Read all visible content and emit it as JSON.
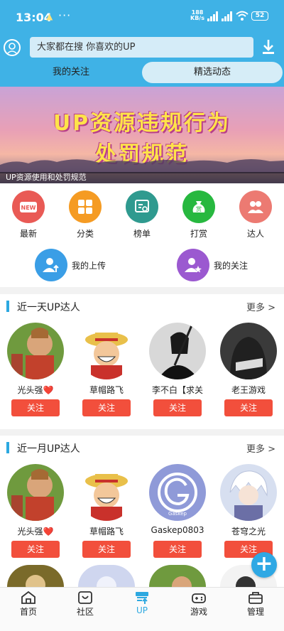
{
  "status_bar": {
    "time": "13:04",
    "dots": "···",
    "net_speed_top": "188",
    "net_speed_bottom": "KB/s",
    "battery": "52"
  },
  "search": {
    "placeholder": "大家都在搜  你喜欢的UP"
  },
  "tabs": [
    {
      "label": "我的关注"
    },
    {
      "label": "精选动态"
    }
  ],
  "banner": {
    "line1": "UP资源违规行为",
    "line2": "处罚规范",
    "caption": "UP资源使用和处罚规范"
  },
  "quick_menu": [
    {
      "label": "最新",
      "color": "#e95a55",
      "icon": "new-badge-icon",
      "badge": "NEW"
    },
    {
      "label": "分类",
      "color": "#f59b23",
      "icon": "grid-icon"
    },
    {
      "label": "榜单",
      "color": "#2f9a8f",
      "icon": "ranking-icon"
    },
    {
      "label": "打赏",
      "color": "#27b83f",
      "icon": "money-bag-icon",
      "badge": "赏"
    },
    {
      "label": "达人",
      "color": "#ec7a72",
      "icon": "people-icon"
    }
  ],
  "quick_menu_row2": [
    {
      "label": "我的上传",
      "color": "#3a9ee6",
      "icon": "upload-user-icon"
    },
    {
      "label": "我的关注",
      "color": "#9b59d0",
      "icon": "star-user-icon"
    }
  ],
  "sections": [
    {
      "title": "近一天UP达人",
      "more": "更多 >",
      "users": [
        {
          "name": "光头强❤️",
          "follow": "关注",
          "avatar": "bald-man-avatar"
        },
        {
          "name": "草帽路飞",
          "follow": "关注",
          "avatar": "straw-hat-avatar"
        },
        {
          "name": "李不白【求关",
          "follow": "关注",
          "avatar": "swordsman-avatar"
        },
        {
          "name": "老王游戏",
          "follow": "关注",
          "avatar": "hooded-figure-avatar"
        }
      ]
    },
    {
      "title": "近一月UP达人",
      "more": "更多 >",
      "users": [
        {
          "name": "光头强❤️",
          "follow": "关注",
          "avatar": "bald-man-avatar"
        },
        {
          "name": "草帽路飞",
          "follow": "关注",
          "avatar": "straw-hat-avatar"
        },
        {
          "name": "Gaskep0803",
          "follow": "关注",
          "avatar": "g-logo-avatar",
          "logo_text": "Gaskep"
        },
        {
          "name": "苍穹之光",
          "follow": "关注",
          "avatar": "anime-character-avatar"
        }
      ]
    }
  ],
  "fab": {
    "label": "+"
  },
  "bottom_nav": [
    {
      "label": "首页",
      "icon": "home-icon"
    },
    {
      "label": "社区",
      "icon": "community-icon"
    },
    {
      "label": "UP",
      "icon": "up-icon",
      "active": true
    },
    {
      "label": "游戏",
      "icon": "gamepad-icon"
    },
    {
      "label": "管理",
      "icon": "manage-icon"
    }
  ],
  "colors": {
    "primary": "#3fb2e6",
    "follow_button": "#f24f3c",
    "active_nav": "#2ca8e0"
  }
}
